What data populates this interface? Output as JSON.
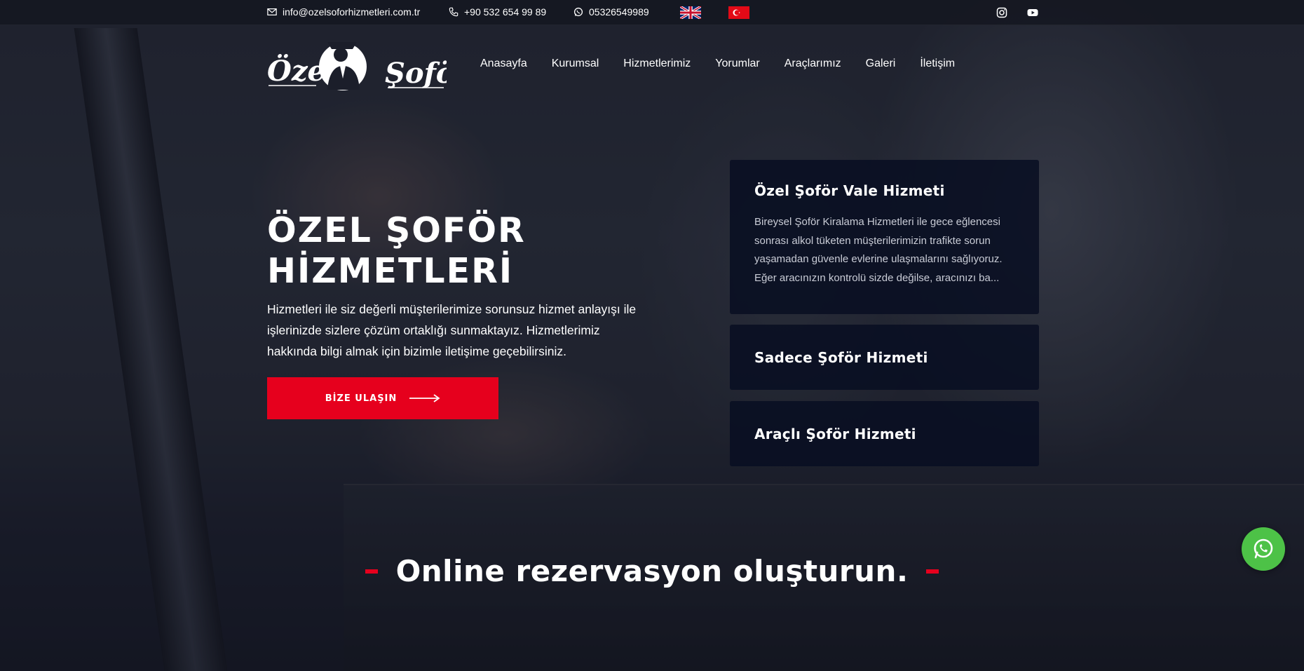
{
  "topbar": {
    "email": "info@ozelsoforhizmetleri.com.tr",
    "phone": "+90 532 654 99 89",
    "whatsapp": "05326549989",
    "icons": [
      "envelope-icon",
      "phone-icon",
      "whatsapp-icon",
      "uk-flag-icon",
      "turkey-flag-icon",
      "instagram-icon",
      "youtube-icon"
    ]
  },
  "logo": {
    "word1": "Özel",
    "word2": "Şoför"
  },
  "nav": {
    "items": [
      "Anasayfa",
      "Kurumsal",
      "Hizmetlerimiz",
      "Yorumlar",
      "Araçlarımız",
      "Galeri",
      "İletişim"
    ]
  },
  "hero": {
    "title_line1": "ÖZEL ŞOFÖR",
    "title_line2": "HİZMETLERİ",
    "text": "Hizmetleri ile siz değerli müşterilerimize sorunsuz hizmet anlayışı ile işlerinizde sizlere çözüm ortaklığı sunmaktayız. Hizmetlerimiz hakkında bilgi almak için bizimle iletişime geçebilirsiniz.",
    "cta_label": "BİZE ULAŞIN"
  },
  "services": [
    {
      "title": "Özel Şoför Vale Hizmeti",
      "description": "Bireysel Şoför Kiralama Hizmetleri ile gece eğlencesi sonrası alkol tüketen müşterilerimizin trafikte sorun yaşamadan güvenle evlerine ulaşmalarını sağlıyoruz. Eğer aracınızın kontrolü sizde değilse, aracınızı ba..."
    },
    {
      "title": "Sadece Şoför Hizmeti"
    },
    {
      "title": "Araçlı Şoför Hizmeti"
    }
  ],
  "section": {
    "heading": "Online rezervasyon oluşturun."
  },
  "colors": {
    "accent": "#e6001d",
    "card_bg": "#080e22",
    "whatsapp": "#4dc247"
  }
}
